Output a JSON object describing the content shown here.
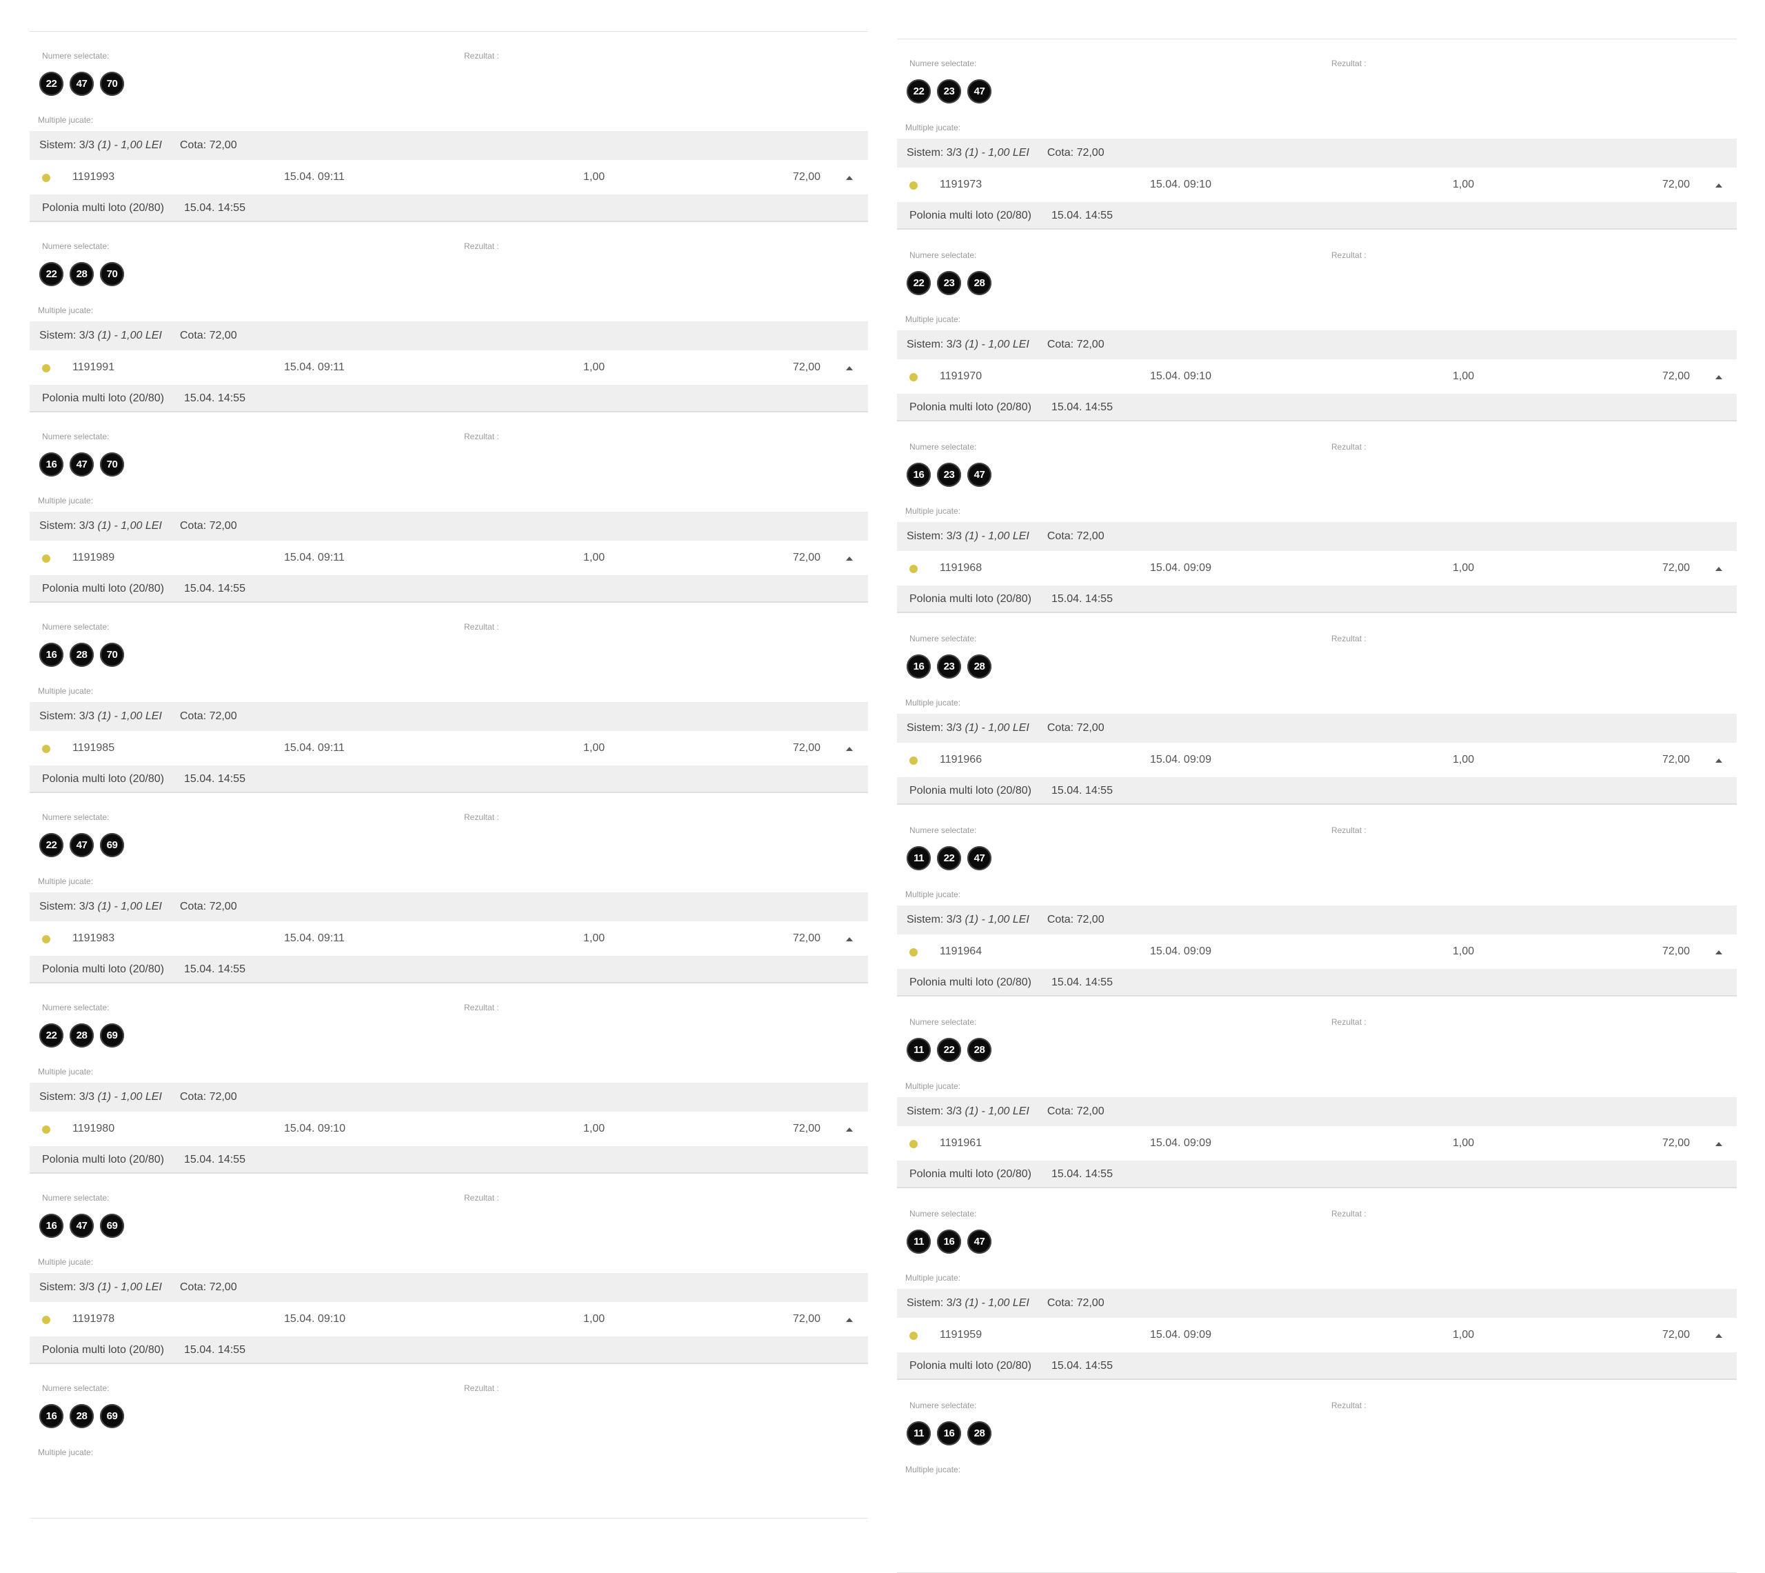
{
  "labels": {
    "selected": "Numere selectate:",
    "result": "Rezultat :",
    "multiples": "Multiple jucate:",
    "system": "Sistem: 3/3",
    "system_count": "(1)",
    "system_stake": "- 1,00 LEI",
    "cota": "Cota: 72,00",
    "game_name": "Polonia multi loto (20/80)",
    "game_date": "15.04. 14:55",
    "stake": "1,00",
    "odds": "72,00"
  },
  "colors": {
    "ball": "#0b0b0b",
    "status_dot": "#d6c54a",
    "bar_background": "#efefef"
  },
  "left_column": [
    {
      "numbers": [
        "22",
        "47",
        "70"
      ],
      "ticket_id": "1191993",
      "time": "15.04. 09:11"
    },
    {
      "numbers": [
        "22",
        "28",
        "70"
      ],
      "ticket_id": "1191991",
      "time": "15.04. 09:11"
    },
    {
      "numbers": [
        "16",
        "47",
        "70"
      ],
      "ticket_id": "1191989",
      "time": "15.04. 09:11"
    },
    {
      "numbers": [
        "16",
        "28",
        "70"
      ],
      "ticket_id": "1191985",
      "time": "15.04. 09:11"
    },
    {
      "numbers": [
        "22",
        "47",
        "69"
      ],
      "ticket_id": "1191983",
      "time": "15.04. 09:11"
    },
    {
      "numbers": [
        "22",
        "28",
        "69"
      ],
      "ticket_id": "1191980",
      "time": "15.04. 09:10"
    },
    {
      "numbers": [
        "16",
        "47",
        "69"
      ],
      "ticket_id": "1191978",
      "time": "15.04. 09:10"
    },
    {
      "numbers": [
        "16",
        "28",
        "69"
      ]
    }
  ],
  "right_column": [
    {
      "numbers": [
        "22",
        "23",
        "47"
      ],
      "ticket_id": "1191973",
      "time": "15.04. 09:10"
    },
    {
      "numbers": [
        "22",
        "23",
        "28"
      ],
      "ticket_id": "1191970",
      "time": "15.04. 09:10"
    },
    {
      "numbers": [
        "16",
        "23",
        "47"
      ],
      "ticket_id": "1191968",
      "time": "15.04. 09:09"
    },
    {
      "numbers": [
        "16",
        "23",
        "28"
      ],
      "ticket_id": "1191966",
      "time": "15.04. 09:09"
    },
    {
      "numbers": [
        "11",
        "22",
        "47"
      ],
      "ticket_id": "1191964",
      "time": "15.04. 09:09"
    },
    {
      "numbers": [
        "11",
        "22",
        "28"
      ],
      "ticket_id": "1191961",
      "time": "15.04. 09:09"
    },
    {
      "numbers": [
        "11",
        "16",
        "47"
      ],
      "ticket_id": "1191959",
      "time": "15.04. 09:09"
    },
    {
      "numbers": [
        "11",
        "16",
        "28"
      ]
    }
  ]
}
